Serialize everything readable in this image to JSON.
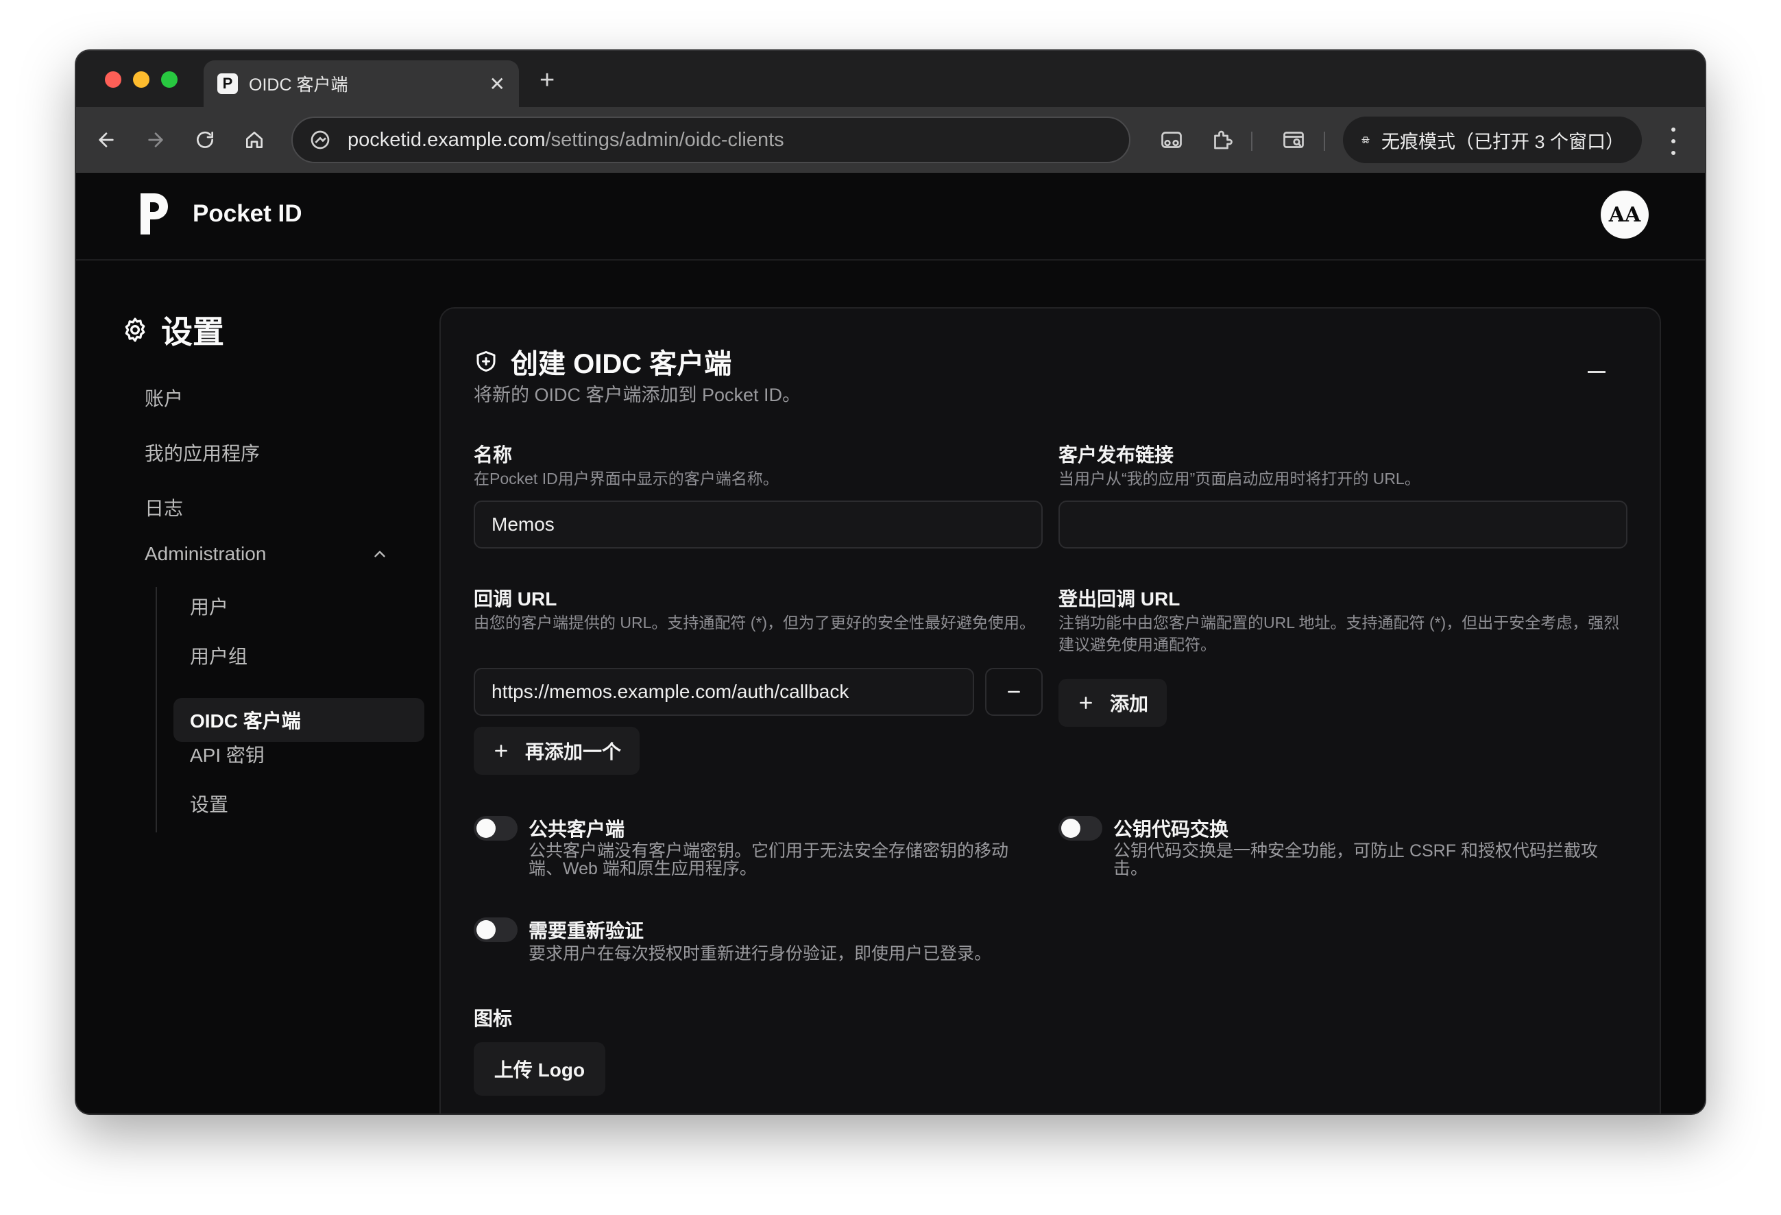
{
  "browser": {
    "tab_title": "OIDC 客户端",
    "tab_favicon": "P",
    "url_host": "pocketid.example.com",
    "url_path": "/settings/admin/oidc-clients",
    "incognito_label": "无痕模式（已打开 3 个窗口）"
  },
  "app": {
    "brand": "Pocket ID",
    "avatar_initials": "AA"
  },
  "sidebar": {
    "title": "设置",
    "items": [
      {
        "label": "账户"
      },
      {
        "label": "我的应用程序"
      },
      {
        "label": "日志"
      }
    ],
    "admin_label": "Administration",
    "admin_items": [
      {
        "label": "用户"
      },
      {
        "label": "用户组"
      },
      {
        "label": "OIDC 客户端",
        "active": true
      },
      {
        "label": "API 密钥"
      },
      {
        "label": "设置"
      }
    ]
  },
  "form": {
    "title": "创建 OIDC 客户端",
    "subtitle": "将新的 OIDC 客户端添加到 Pocket ID。",
    "name": {
      "label": "名称",
      "hint": "在Pocket ID用户界面中显示的客户端名称。",
      "value": "Memos"
    },
    "launch_url": {
      "label": "客户发布链接",
      "hint": "当用户从“我的应用”页面启动应用时将打开的 URL。",
      "value": ""
    },
    "callback_url": {
      "label": "回调 URL",
      "hint": "由您的客户端提供的 URL。支持通配符 (*)，但为了更好的安全性最好避免使用。",
      "value": "https://memos.example.com/auth/callback",
      "add_another_label": "再添加一个"
    },
    "logout_url": {
      "label": "登出回调 URL",
      "hint": "注销功能中由您客户端配置的URL 地址。支持通配符 (*)，但出于安全考虑，强烈建议避免使用通配符。",
      "add_label": "添加"
    },
    "public_client": {
      "label": "公共客户端",
      "hint": "公共客户端没有客户端密钥。它们用于无法安全存储密钥的移动端、Web 端和原生应用程序。",
      "enabled": false
    },
    "pkce": {
      "label": "公钥代码交换",
      "hint": "公钥代码交换是一种安全功能，可防止 CSRF 和授权代码拦截攻击。",
      "enabled": false
    },
    "reauth": {
      "label": "需要重新验证",
      "hint": "要求用户在每次授权时重新进行身份验证，即使用户已登录。",
      "enabled": false
    },
    "icon": {
      "label": "图标",
      "upload_label": "上传 Logo"
    }
  },
  "colors": {
    "background": "#0a0a0b",
    "card": "#111113",
    "accent": "#fafafa",
    "muted_text": "#8e8e93"
  }
}
